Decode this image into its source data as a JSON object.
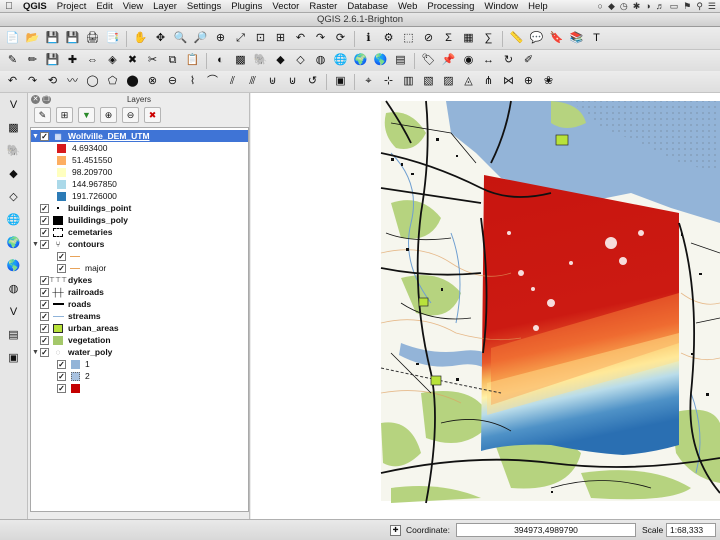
{
  "menubar": {
    "app": "QGIS",
    "items": [
      "Project",
      "Edit",
      "View",
      "Layer",
      "Settings",
      "Plugins",
      "Vector",
      "Raster",
      "Database",
      "Web",
      "Processing",
      "Window",
      "Help"
    ]
  },
  "window": {
    "title": "QGIS 2.6.1-Brighton"
  },
  "layers_panel": {
    "title": "Layers",
    "layers": [
      {
        "name": "Wolfville_DEM_UTM",
        "selected": true,
        "legend": [
          {
            "label": "4.693400",
            "color": "#d7191c"
          },
          {
            "label": "51.451550",
            "color": "#fdae61"
          },
          {
            "label": "98.209700",
            "color": "#ffffbf"
          },
          {
            "label": "144.967850",
            "color": "#abd9e9"
          },
          {
            "label": "191.726000",
            "color": "#2c7bb6"
          }
        ]
      },
      {
        "name": "buildings_point"
      },
      {
        "name": "buildings_poly"
      },
      {
        "name": "cemetaries"
      },
      {
        "name": "contours",
        "legend": [
          {
            "label": "",
            "color": "#e8a35a"
          },
          {
            "label": "major",
            "color": "#e8a35a"
          }
        ]
      },
      {
        "name": "dykes"
      },
      {
        "name": "railroads"
      },
      {
        "name": "roads"
      },
      {
        "name": "streams"
      },
      {
        "name": "urban_areas"
      },
      {
        "name": "vegetation"
      },
      {
        "name": "water_poly",
        "legend": [
          {
            "label": "1",
            "color": "#93b4d8"
          },
          {
            "label": "2",
            "color": "#a9c2e0"
          },
          {
            "label": "",
            "color": "#c40000"
          }
        ]
      }
    ]
  },
  "status": {
    "coordinate_label": "Coordinate:",
    "coordinate_value": "394973,4989790",
    "scale_label": "Scale",
    "scale_value": "1:68,333"
  },
  "colors": {
    "selection": "#3f74d6",
    "dem_low": "#d7191c",
    "dem_high": "#2c7bb6",
    "water": "#93b4d8",
    "vegetation": "#b6d37f"
  }
}
